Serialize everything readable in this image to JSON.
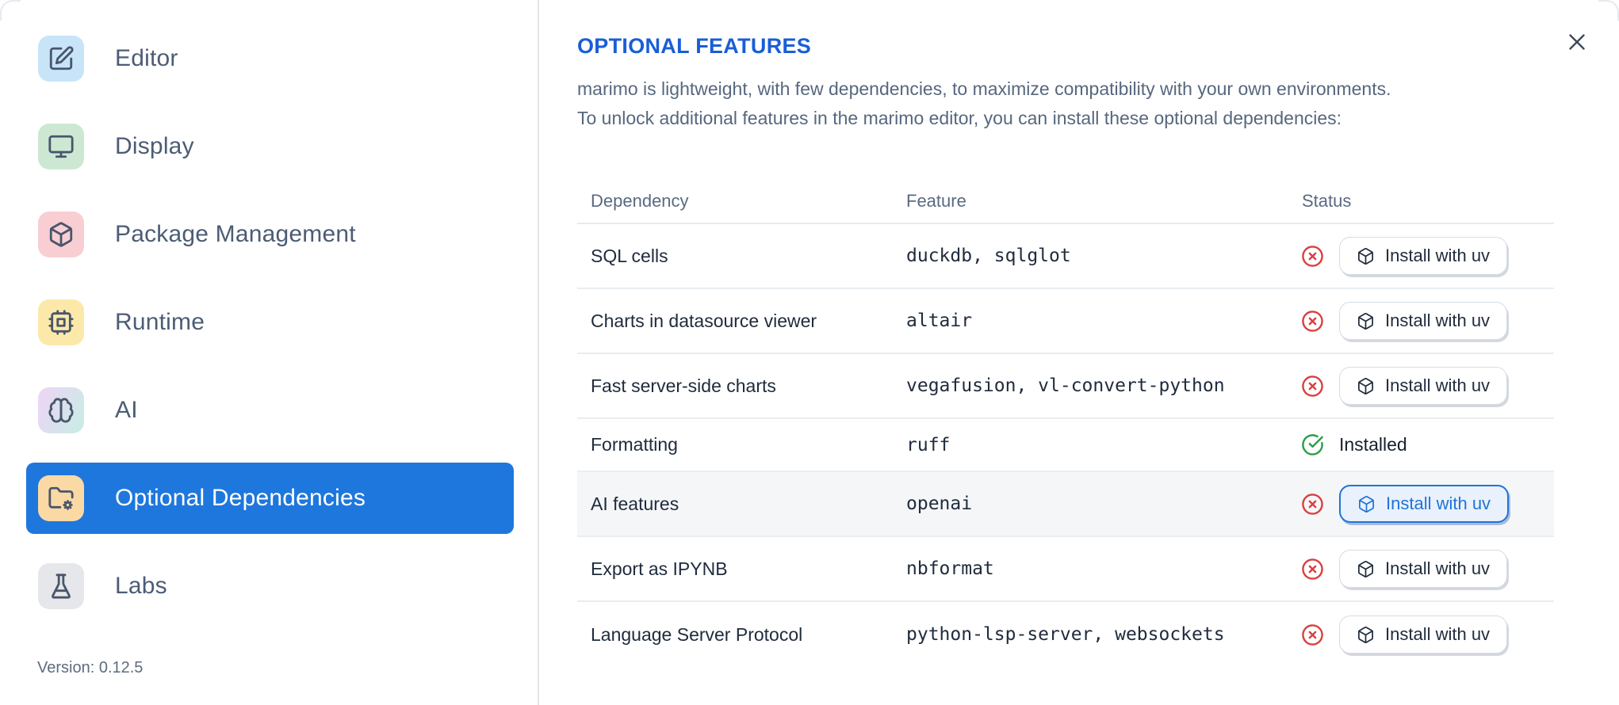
{
  "sidebar": {
    "items": [
      {
        "label": "Editor",
        "icon": "edit-icon",
        "icon_bg": "#c8e4f8",
        "selected": false
      },
      {
        "label": "Display",
        "icon": "monitor-icon",
        "icon_bg": "#cde8d2",
        "selected": false
      },
      {
        "label": "Package Management",
        "icon": "package-icon",
        "icon_bg": "#f9ced3",
        "selected": false
      },
      {
        "label": "Runtime",
        "icon": "cpu-icon",
        "icon_bg": "#fce9a9",
        "selected": false
      },
      {
        "label": "AI",
        "icon": "brain-icon",
        "icon_bg": "linear-gradient(115deg, #e9d7f4 15%, #cdeae7 85%)",
        "selected": false
      },
      {
        "label": "Optional Dependencies",
        "icon": "folder-cog-icon",
        "icon_bg": "#fbd9a4",
        "selected": true
      },
      {
        "label": "Labs",
        "icon": "flask-icon",
        "icon_bg": "#e6e7ea",
        "selected": false
      }
    ],
    "selected_bg": "#1e77dd",
    "version_label": "Version: 0.12.5"
  },
  "dialog": {
    "title": "OPTIONAL FEATURES",
    "title_color": "#1a5ed6",
    "description_lines": [
      "marimo is lightweight, with few dependencies, to maximize compatibility with your own environments.",
      "To unlock additional features in the marimo editor, you can install these optional dependencies:"
    ]
  },
  "table": {
    "columns": [
      "Dependency",
      "Feature",
      "Status"
    ],
    "install_button_label": "Install with uv",
    "installed_label": "Installed",
    "status_colors": {
      "missing": "#d94040",
      "installed": "#2c9e45"
    },
    "rows": [
      {
        "dependency": "SQL cells",
        "feature": "duckdb, sqlglot",
        "status": "missing"
      },
      {
        "dependency": "Charts in datasource viewer",
        "feature": "altair",
        "status": "missing"
      },
      {
        "dependency": "Fast server-side charts",
        "feature": "vegafusion, vl-convert-python",
        "status": "missing"
      },
      {
        "dependency": "Formatting",
        "feature": "ruff",
        "status": "installed"
      },
      {
        "dependency": "AI features",
        "feature": "openai",
        "status": "missing",
        "highlighted": true,
        "button_focused": true
      },
      {
        "dependency": "Export as IPYNB",
        "feature": "nbformat",
        "status": "missing"
      },
      {
        "dependency": "Language Server Protocol",
        "feature": "python-lsp-server, websockets",
        "status": "missing"
      }
    ]
  }
}
